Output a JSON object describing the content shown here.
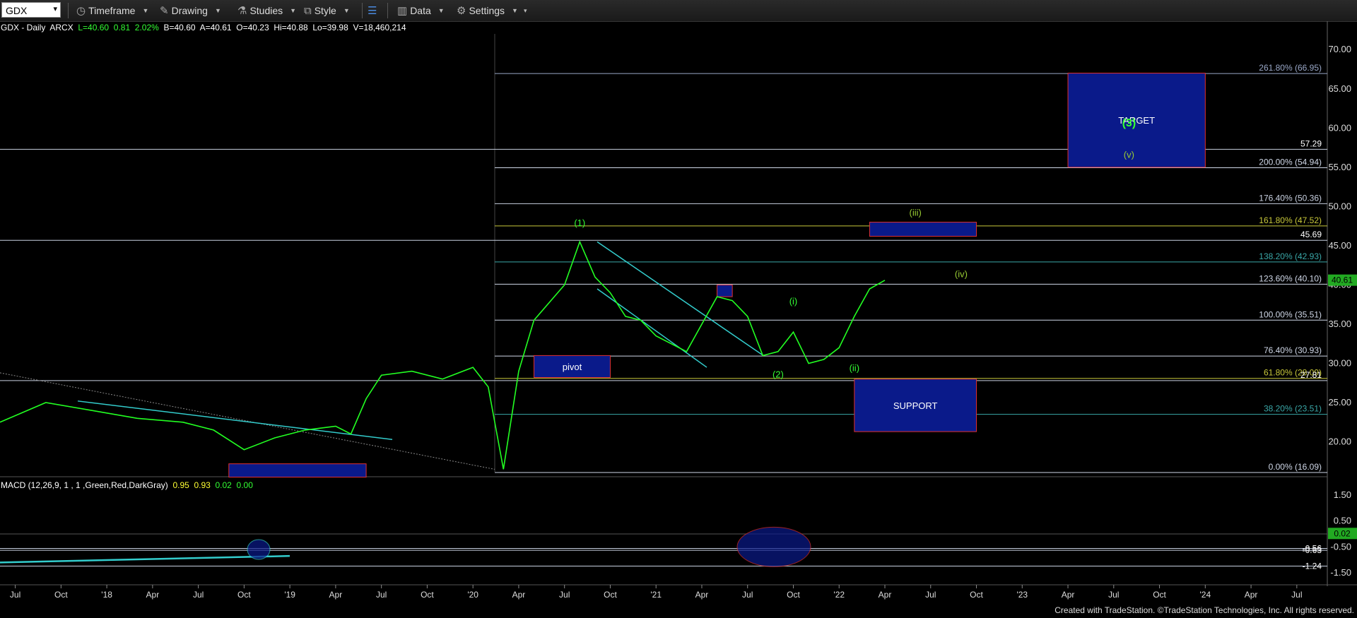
{
  "toolbar": {
    "symbol": "GDX",
    "items": [
      {
        "label": "Timeframe",
        "icon": "clock-icon"
      },
      {
        "label": "Drawing",
        "icon": "pencil-icon"
      },
      {
        "label": "Studies",
        "icon": "flask-icon"
      },
      {
        "label": "Style",
        "icon": "chart-style-icon"
      },
      {
        "label": "Data",
        "icon": "data-bars-icon"
      },
      {
        "label": "Settings",
        "icon": "gear-icon"
      }
    ]
  },
  "info_line": {
    "symbol": "GDX - Daily",
    "exchange": "ARCX",
    "last": "L=40.60",
    "change": "0.81",
    "pct": "2.02%",
    "bid": "B=40.60",
    "ask": "A=40.61",
    "open": "O=40.23",
    "high": "Hi=40.88",
    "low": "Lo=39.98",
    "volume": "V=18,460,214"
  },
  "macd_info": {
    "label": "MACD (12,26,9, 1 , 1 ,Green,Red,DarkGray)",
    "v1": "0.95",
    "v2": "0.93",
    "v3": "0.02",
    "v4": "0.00"
  },
  "footer": "Created with TradeStation. ©TradeStation Technologies, Inc. All rights reserved.",
  "chart_data": {
    "type": "line",
    "timeframe": "Daily",
    "x": [
      "2017-06",
      "2017-09",
      "2017-12",
      "2018-03",
      "2018-06",
      "2018-08",
      "2018-10",
      "2018-12",
      "2019-02",
      "2019-04",
      "2019-05",
      "2019-06",
      "2019-07",
      "2019-09",
      "2019-11",
      "2020-01",
      "2020-02",
      "2020-03",
      "2020-04",
      "2020-05",
      "2020-07",
      "2020-08",
      "2020-09",
      "2020-10",
      "2020-11",
      "2020-12",
      "2021-01",
      "2021-03",
      "2021-05",
      "2021-06",
      "2021-07",
      "2021-08",
      "2021-09",
      "2021-10",
      "2021-11",
      "2021-12",
      "2022-01",
      "2022-02",
      "2022-03",
      "2022-04"
    ],
    "y": [
      22.5,
      25.0,
      24.0,
      23.0,
      22.5,
      21.5,
      19.0,
      20.5,
      21.5,
      22.0,
      21.0,
      25.5,
      28.5,
      29.0,
      28.0,
      29.5,
      27.0,
      16.5,
      29.0,
      35.5,
      40.0,
      45.5,
      41.0,
      39.0,
      36.0,
      35.5,
      33.5,
      31.5,
      38.5,
      38.0,
      36.0,
      31.0,
      31.5,
      34.0,
      30.0,
      30.5,
      32.0,
      36.0,
      39.5,
      40.6
    ],
    "y_axis": {
      "min": 16,
      "max": 72,
      "ticks": [
        70,
        65,
        60,
        55,
        50,
        45,
        40,
        35,
        30,
        25,
        20
      ]
    },
    "x_ticks": [
      "Jul",
      "Oct",
      "'18",
      "Apr",
      "Jul",
      "Oct",
      "'19",
      "Apr",
      "Jul",
      "Oct",
      "'20",
      "Apr",
      "Jul",
      "Oct",
      "'21",
      "Apr",
      "Jul",
      "Oct",
      "'22",
      "Apr",
      "Jul",
      "Oct",
      "'23",
      "Apr",
      "Jul",
      "Oct",
      "'24",
      "Apr",
      "Jul"
    ],
    "fib_levels": [
      {
        "label": "261.80% (66.95)",
        "value": 66.95,
        "color": "#9aa8c8"
      },
      {
        "label": "200.00% (54.94)",
        "value": 54.94,
        "color": "#d0d8e8"
      },
      {
        "label": "176.40% (50.36)",
        "value": 50.36,
        "color": "#c8d0e0"
      },
      {
        "label": "161.80% (47.52)",
        "value": 47.52,
        "color": "#c8c83a"
      },
      {
        "label": "138.20% (42.93)",
        "value": 42.93,
        "color": "#3aa8a8"
      },
      {
        "label": "123.60% (40.10)",
        "value": 40.1,
        "color": "#d0d8e8"
      },
      {
        "label": "100.00% (35.51)",
        "value": 35.51,
        "color": "#d0d8e8"
      },
      {
        "label": "76.40% (30.93)",
        "value": 30.93,
        "color": "#d0d8e8"
      },
      {
        "label": "61.80% (28.09)",
        "value": 28.09,
        "color": "#c8c83a"
      },
      {
        "label": "38.20% (23.51)",
        "value": 23.51,
        "color": "#3aa8a8"
      },
      {
        "label": "0.00% (16.09)",
        "value": 16.09,
        "color": "#d0d8e8"
      }
    ],
    "h_levels": [
      {
        "label": "57.29",
        "value": 57.29
      },
      {
        "label": "45.69",
        "value": 45.69
      },
      {
        "label": "27.81",
        "value": 27.81
      }
    ],
    "last_price": "40.61",
    "boxes": [
      {
        "label": "TARGET",
        "from": "2023-04",
        "to": "2024-01",
        "low": 55.0,
        "high": 67.0
      },
      {
        "label": "",
        "from": "2022-03",
        "to": "2022-10",
        "low": 46.2,
        "high": 48.0
      },
      {
        "label": "SUPPORT",
        "from": "2022-02",
        "to": "2022-10",
        "low": 21.3,
        "high": 28.0
      },
      {
        "label": "pivot",
        "from": "2020-05",
        "to": "2020-10",
        "low": 28.2,
        "high": 31.0
      },
      {
        "label": "",
        "from": "2021-05",
        "to": "2021-06",
        "low": 38.5,
        "high": 40.0
      },
      {
        "label": "",
        "from": "2018-09",
        "to": "2019-06",
        "low": 15.5,
        "high": 17.2
      }
    ],
    "wave_labels": [
      {
        "text": "(1)",
        "color": "#3f3"
      },
      {
        "text": "(2)",
        "color": "#3f3"
      },
      {
        "text": "(3)",
        "color": "#3f3"
      },
      {
        "text": "(i)",
        "color": "#3f3"
      },
      {
        "text": "(ii)",
        "color": "#3f3"
      },
      {
        "text": "(iii)",
        "color": "#9c3"
      },
      {
        "text": "(iv)",
        "color": "#9c3"
      },
      {
        "text": "(v)",
        "color": "#9c3"
      }
    ],
    "macd": {
      "y_ticks": [
        "1.50",
        "0.50",
        "-0.50",
        "-1.50"
      ],
      "marks": [
        "-0.56",
        "-0.63",
        "-1.24"
      ],
      "last": "0.02"
    }
  }
}
